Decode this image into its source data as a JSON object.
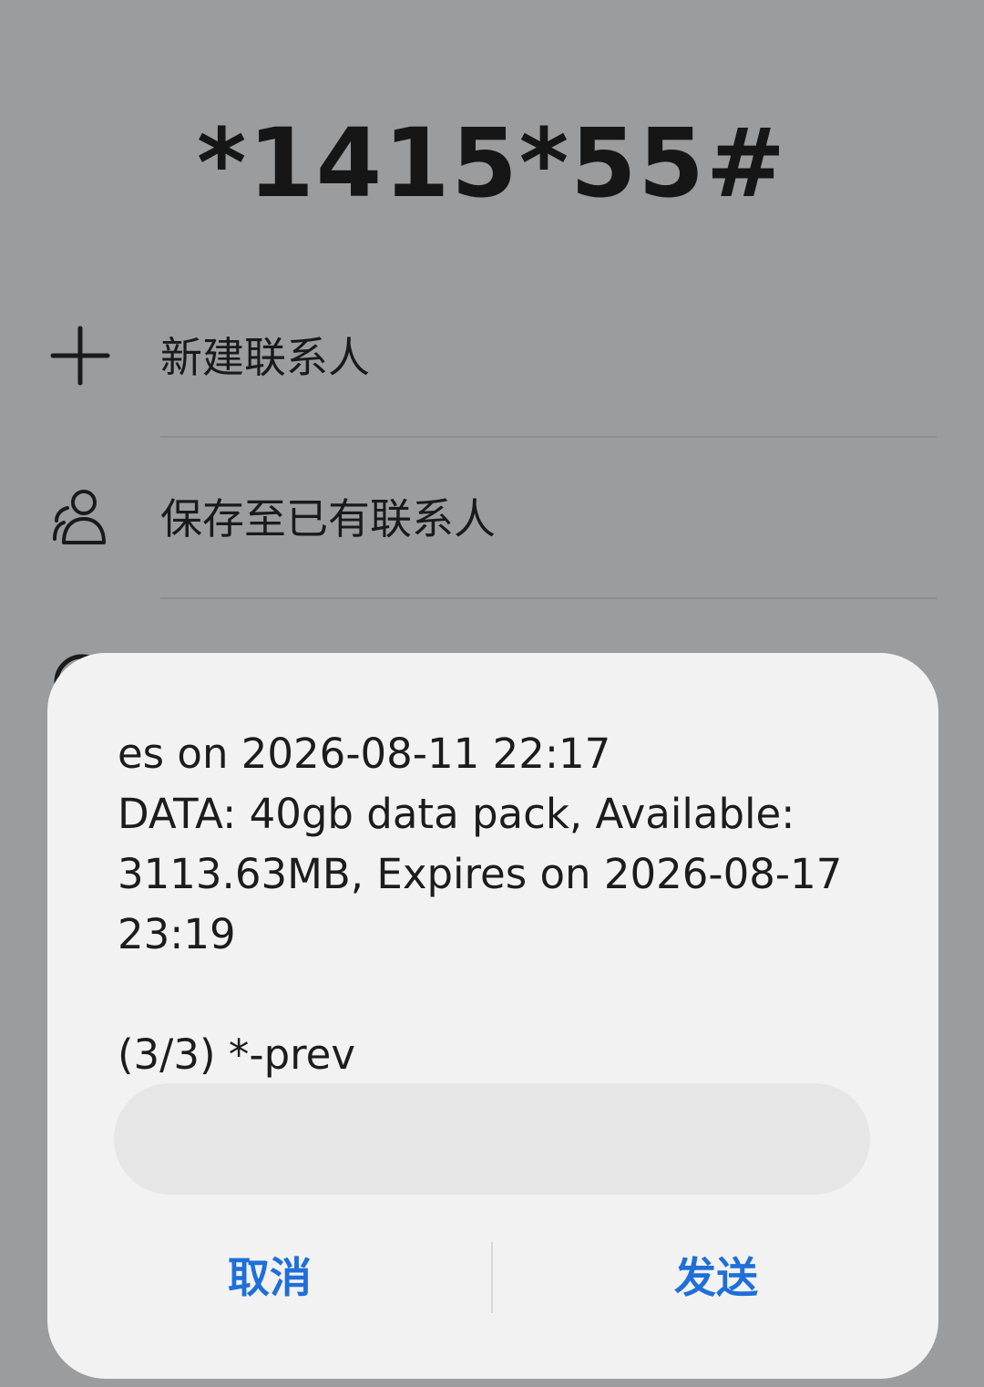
{
  "dialer": {
    "number": "*1415*55#"
  },
  "options": [
    {
      "label": "新建联系人",
      "icon": "plus-icon"
    },
    {
      "label": "保存至已有联系人",
      "icon": "contacts-icon"
    }
  ],
  "ussd_dialog": {
    "message": "es on 2026-08-11 22:17\nDATA: 40gb data pack, Available: 3113.63MB, Expires on 2026-08-17 23:19\n\n(3/3) *-prev",
    "input_value": "",
    "input_placeholder": "",
    "cancel_label": "取消",
    "send_label": "发送"
  },
  "colors": {
    "background_dim": "#9a9c9e",
    "dialog_bg": "#f2f2f2",
    "input_bg": "#e6e6e6",
    "accent": "#1f6fd8"
  }
}
